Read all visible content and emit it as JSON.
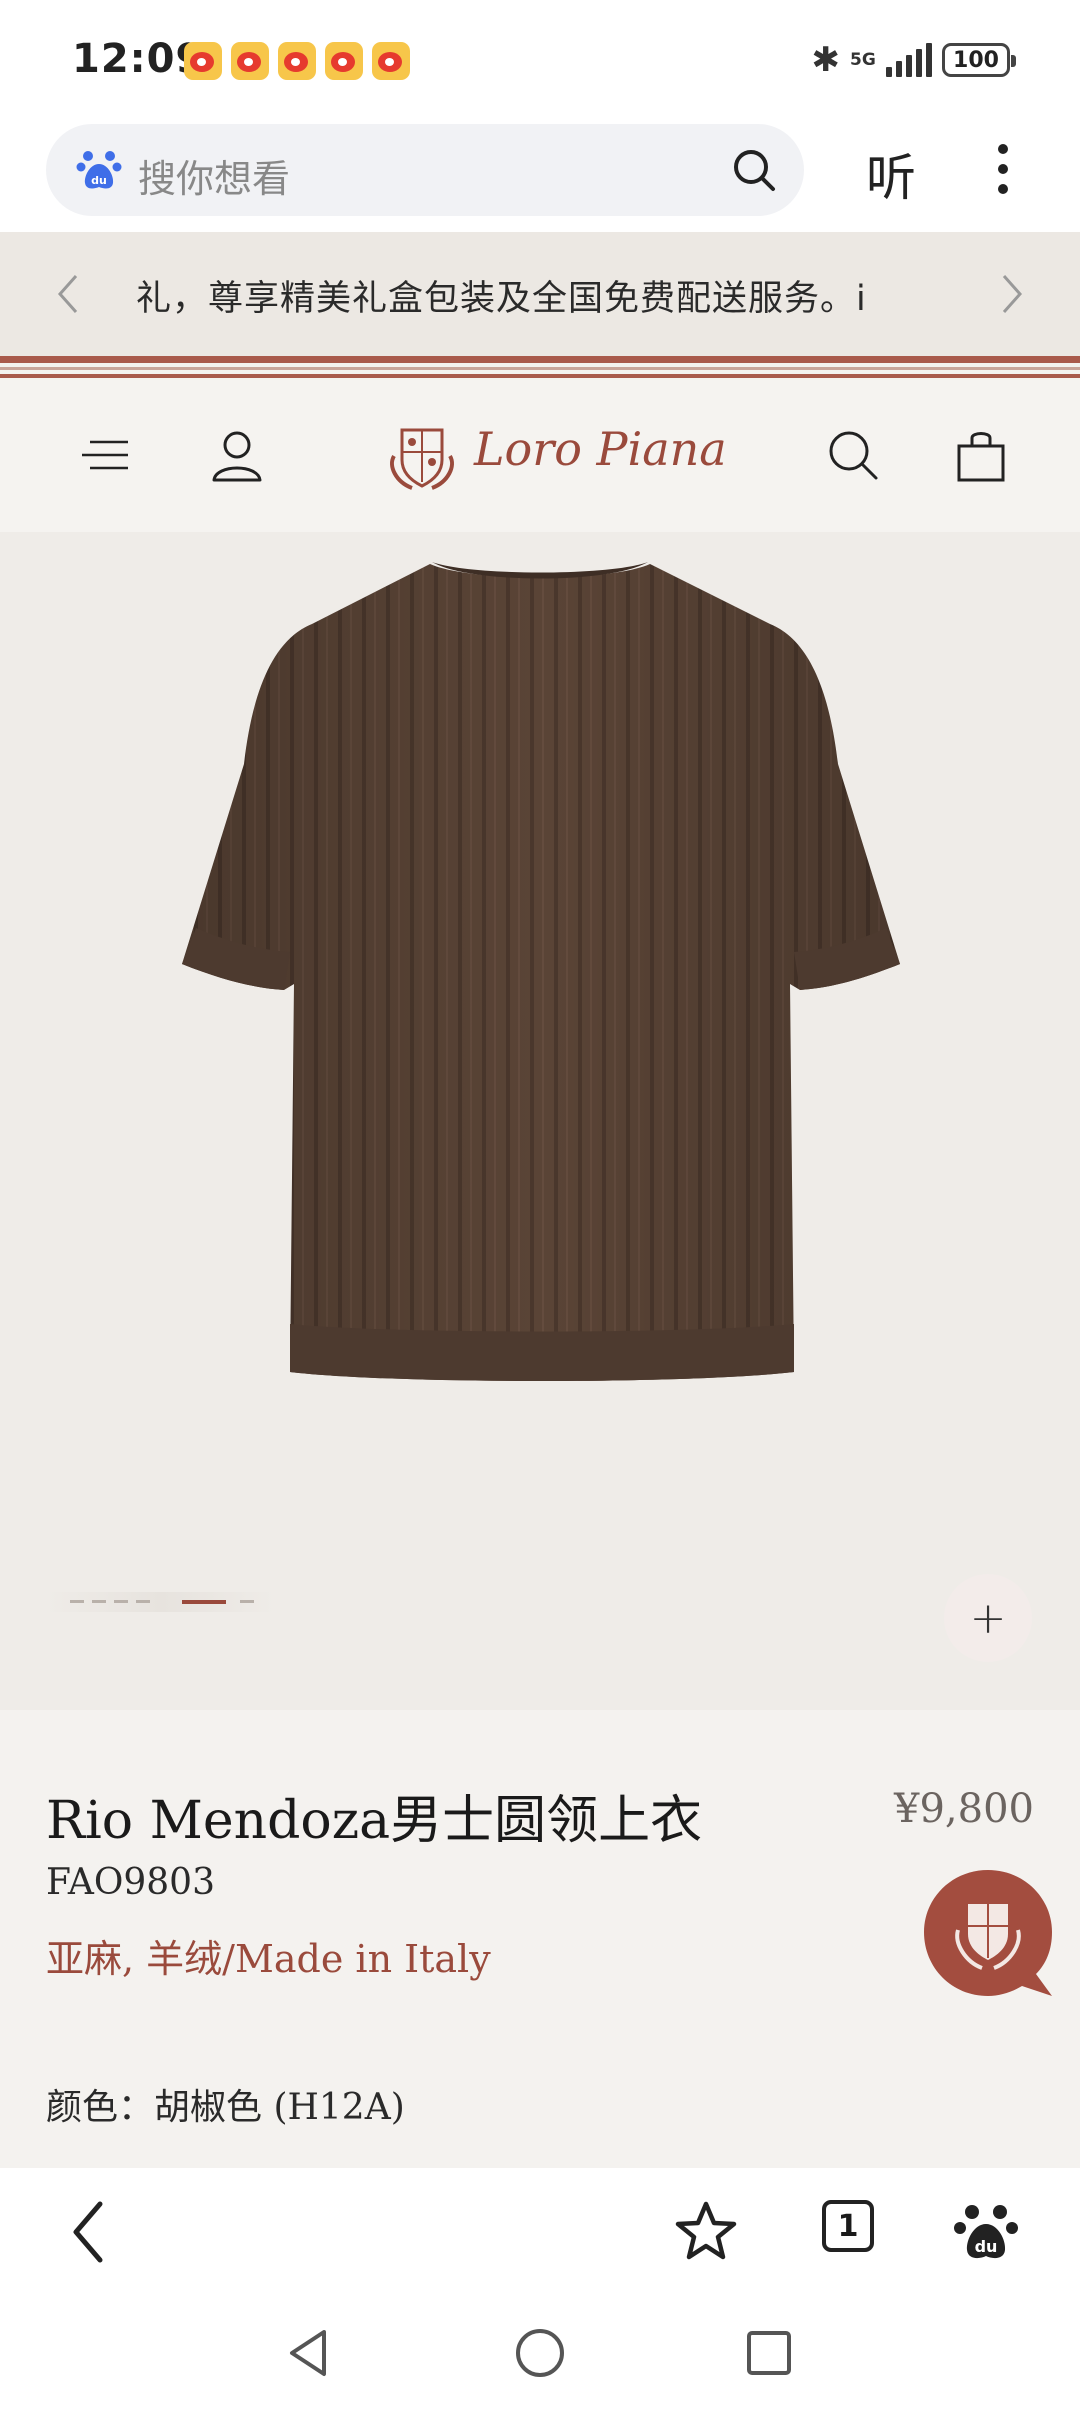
{
  "status_bar": {
    "time": "12:09",
    "notification_icons": [
      "weibo-icon",
      "weibo-icon",
      "weibo-icon",
      "weibo-icon",
      "weibo-icon"
    ],
    "network": "5G",
    "battery": "100"
  },
  "browser": {
    "search_placeholder": "搜你想看",
    "listen_label": "听"
  },
  "announcement": {
    "text": "礼，尊享精美礼盒包装及全国免费配送服务。i"
  },
  "site": {
    "brand": "Loro Piana"
  },
  "gallery": {
    "total_images": 7,
    "active_index": 5,
    "zoom_label": "+"
  },
  "product": {
    "title": "Rio Mendoza男士圆领上衣",
    "price": "¥9,800",
    "code": "FAO9803",
    "material": "亚麻, 羊绒/Made in Italy",
    "color_line": "颜色：胡椒色 (H12A)"
  },
  "toolbar": {
    "tab_count": "1"
  },
  "colors": {
    "brand": "#9a4a3c",
    "shirt": "#5a4436",
    "header_bg": "#f5f3f0"
  }
}
